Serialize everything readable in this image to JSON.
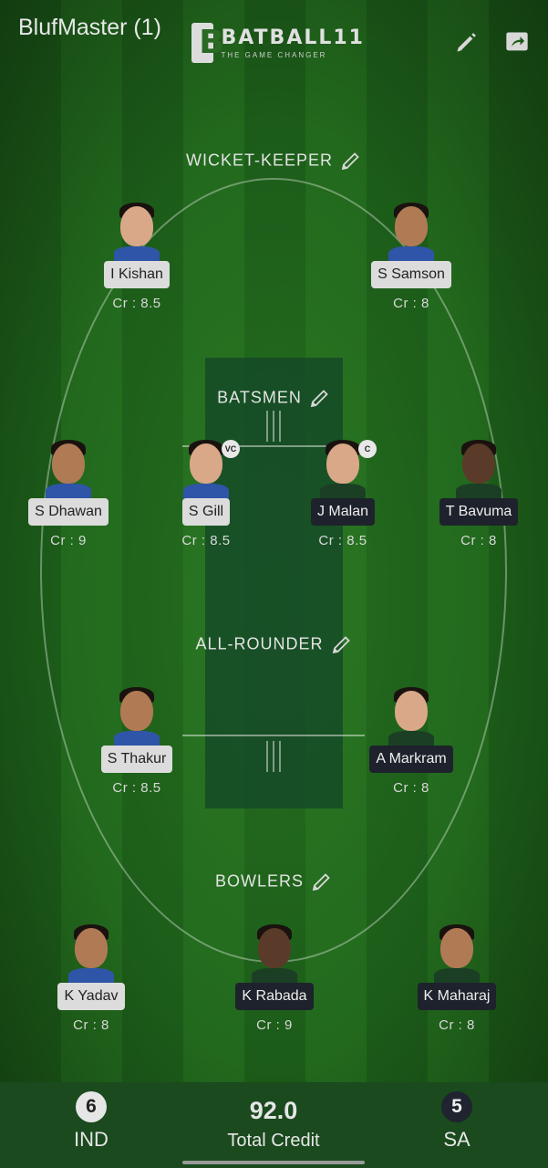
{
  "header": {
    "team_title": "BlufMaster (1)",
    "logo_name": "BATBALL11",
    "logo_tagline": "THE GAME CHANGER",
    "edit_icon": "pencil-icon",
    "share_icon": "share-icon"
  },
  "sections": {
    "wicket_keeper": "WICKET-KEEPER",
    "batsmen": "BATSMEN",
    "all_rounder": "ALL-ROUNDER",
    "bowlers": "BOWLERS"
  },
  "players": {
    "kishan": {
      "name": "I Kishan",
      "credit": "Cr : 8.5",
      "team": "IND"
    },
    "samson": {
      "name": "S Samson",
      "credit": "Cr : 8",
      "team": "IND"
    },
    "dhawan": {
      "name": "S Dhawan",
      "credit": "Cr : 9",
      "team": "IND"
    },
    "gill": {
      "name": "S Gill",
      "credit": "Cr : 8.5",
      "team": "IND",
      "badge": "VC"
    },
    "malan": {
      "name": "J Malan",
      "credit": "Cr : 8.5",
      "team": "SA",
      "badge": "C"
    },
    "bavuma": {
      "name": "T Bavuma",
      "credit": "Cr : 8",
      "team": "SA"
    },
    "thakur": {
      "name": "S Thakur",
      "credit": "Cr : 8.5",
      "team": "IND"
    },
    "markram": {
      "name": "A Markram",
      "credit": "Cr : 8",
      "team": "SA"
    },
    "yadav": {
      "name": "K Yadav",
      "credit": "Cr : 8",
      "team": "IND"
    },
    "rabada": {
      "name": "K Rabada",
      "credit": "Cr : 9",
      "team": "SA"
    },
    "maharaj": {
      "name": "K Maharaj",
      "credit": "Cr : 8",
      "team": "SA"
    }
  },
  "footer": {
    "team1_count": "6",
    "team1_name": "IND",
    "total_value": "92.0",
    "total_label": "Total Credit",
    "team2_count": "5",
    "team2_name": "SA"
  },
  "colors": {
    "ind_tag": "#dcdcdc",
    "sa_tag": "#1e222c",
    "field_green": "#1c5c19"
  }
}
